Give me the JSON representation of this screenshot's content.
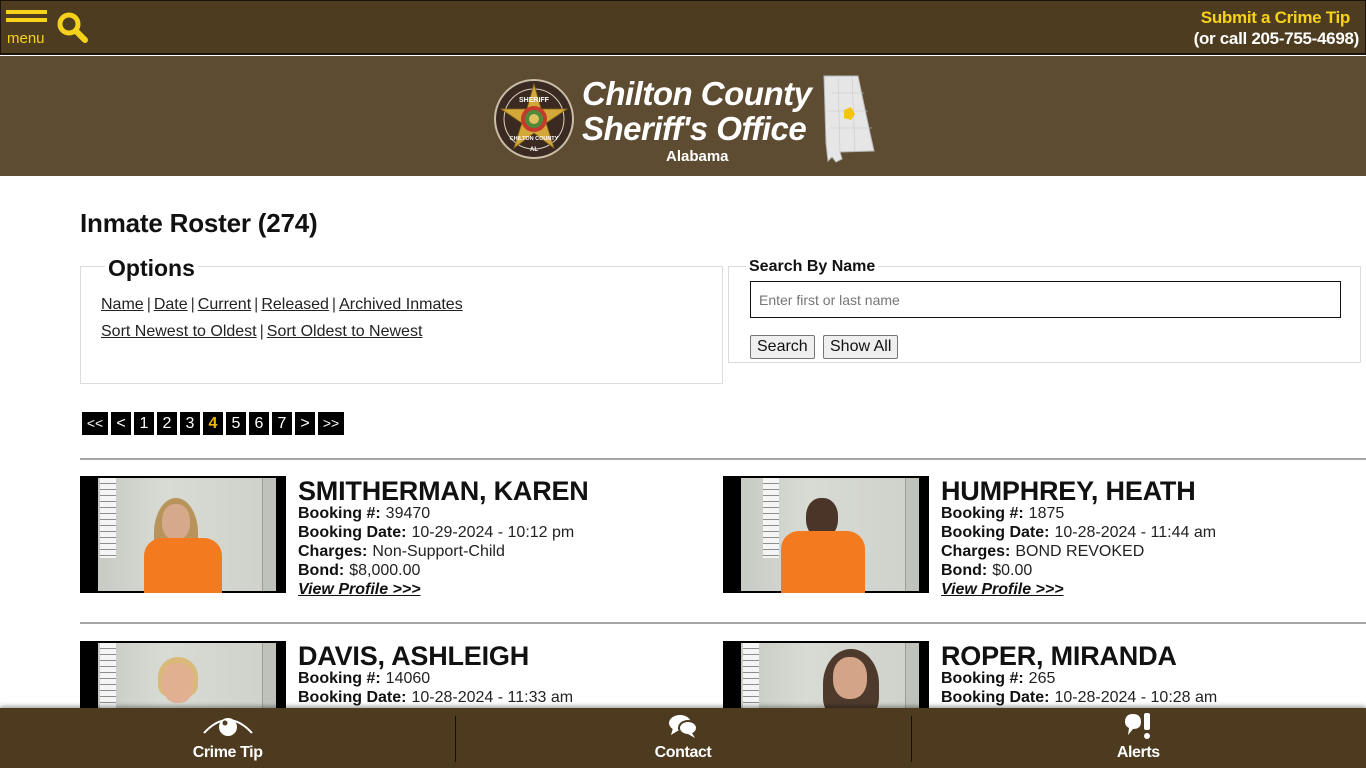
{
  "topbar": {
    "menu_label": "menu",
    "crime_tip_title": "Submit a Crime Tip",
    "crime_tip_phone": "(or call 205-755-4698)"
  },
  "header": {
    "line1": "Chilton County",
    "line2": "Sheriff's Office",
    "state": "Alabama",
    "badge_text_top": "SHERIFF",
    "badge_text_bottom": "CHILTON COUNTY",
    "badge_text_al": "AL"
  },
  "page": {
    "title": "Inmate Roster (274)"
  },
  "options": {
    "legend": "Options",
    "filters": [
      "Name",
      "Date",
      "Current",
      "Released",
      "Archived Inmates"
    ],
    "sorts": [
      "Sort Newest to Oldest",
      "Sort Oldest to Newest"
    ],
    "separator": "|"
  },
  "search": {
    "legend": "Search By Name",
    "placeholder": "Enter first or last name",
    "value": "",
    "search_button": "Search",
    "show_all_button": "Show All"
  },
  "pagination": {
    "first": "<<",
    "prev": "<",
    "pages": [
      "1",
      "2",
      "3",
      "4",
      "5",
      "6",
      "7"
    ],
    "current": "4",
    "next": ">",
    "last": ">>"
  },
  "labels": {
    "booking_no": "Booking #:",
    "booking_date": "Booking Date:",
    "charges": "Charges:",
    "bond": "Bond:",
    "view_profile": "View Profile >>>"
  },
  "inmates": [
    {
      "name": "SMITHERMAN, KAREN",
      "booking_no": "39470",
      "booking_date": "10-29-2024 - 10:12 pm",
      "charges": "Non-Support-Child",
      "bond": "$8,000.00"
    },
    {
      "name": "HUMPHREY, HEATH",
      "booking_no": "1875",
      "booking_date": "10-28-2024 - 11:44 am",
      "charges": "BOND REVOKED",
      "bond": "$0.00"
    },
    {
      "name": "DAVIS, ASHLEIGH",
      "booking_no": "14060",
      "booking_date": "10-28-2024 - 11:33 am"
    },
    {
      "name": "ROPER, MIRANDA",
      "booking_no": "265",
      "booking_date": "10-28-2024 - 10:28 am"
    }
  ],
  "bottom_nav": {
    "items": [
      {
        "label": "Crime Tip",
        "icon": "eye-icon"
      },
      {
        "label": "Contact",
        "icon": "chat-bubbles-icon"
      },
      {
        "label": "Alerts",
        "icon": "alert-bubble-icon"
      }
    ]
  },
  "colors": {
    "topbar_bg": "#4d3c1f",
    "banner_bg": "#5e4c32",
    "accent_yellow": "#f7d21a",
    "current_page": "#f2b705",
    "bottom_nav_bg": "#4d3a1f"
  }
}
